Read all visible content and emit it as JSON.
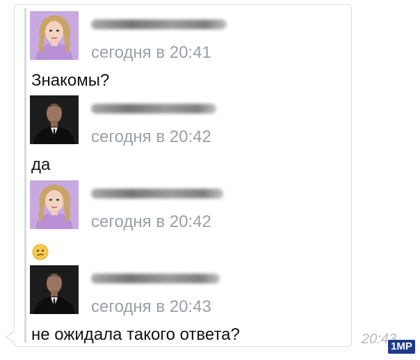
{
  "messages": [
    {
      "avatar": "girl-avatar",
      "time": "сегодня в 20:41",
      "text": "Знакомы?"
    },
    {
      "avatar": "man-avatar",
      "time": "сегодня в 20:42",
      "text": "да"
    },
    {
      "avatar": "girl-avatar",
      "time": "сегодня в 20:42",
      "text": "",
      "emoji": "confused-face-emoji"
    },
    {
      "avatar": "man-avatar",
      "time": "сегодня в 20:43",
      "text": "не ожидала такого ответа?"
    }
  ],
  "outer_time": "20:43",
  "watermark": "1MP",
  "colors": {
    "time": "#9b9ea3",
    "text": "#111111",
    "bubble_border": "#d9dde2",
    "quote_bar": "#d7d9dc"
  }
}
